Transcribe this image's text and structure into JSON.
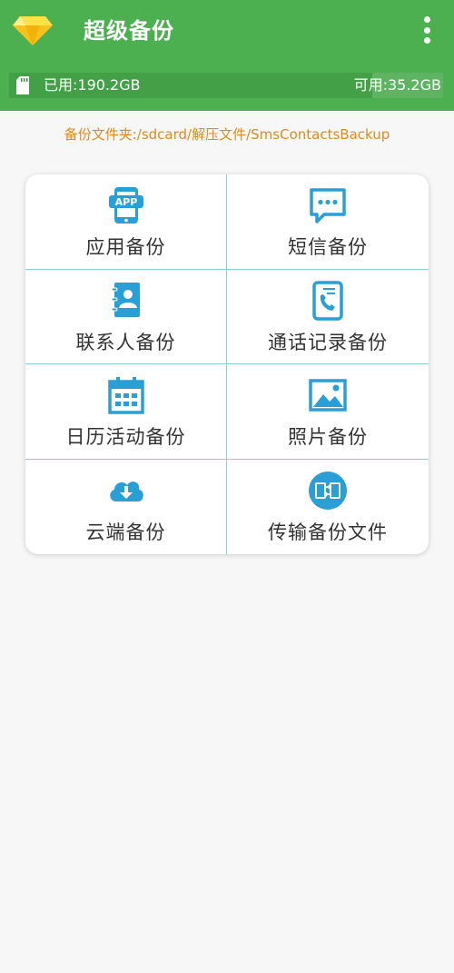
{
  "header": {
    "title": "超级备份",
    "logo_icon": "diamond-icon",
    "menu_icon": "more-vertical-icon",
    "background": "#4caf50"
  },
  "storage": {
    "used_label": "已用:190.2GB",
    "available_label": "可用:35.2GB",
    "used_fraction": 0.844,
    "icon": "sd-card-icon"
  },
  "backup_path": "备份文件夹:/sdcard/解压文件/SmsContactsBackup",
  "menu_items": [
    {
      "label": "应用备份",
      "icon": "app-icon"
    },
    {
      "label": "短信备份",
      "icon": "message-icon"
    },
    {
      "label": "联系人备份",
      "icon": "contacts-icon"
    },
    {
      "label": "通话记录备份",
      "icon": "call-log-icon"
    },
    {
      "label": "日历活动备份",
      "icon": "calendar-icon"
    },
    {
      "label": "照片备份",
      "icon": "photo-icon"
    },
    {
      "label": "云端备份",
      "icon": "cloud-download-icon"
    },
    {
      "label": "传输备份文件",
      "icon": "transfer-icon"
    }
  ],
  "colors": {
    "accent": "#4caf50",
    "icon_blue": "#2a9fd6",
    "path_orange": "#e08a1c",
    "divider": "#8ccfd6"
  }
}
